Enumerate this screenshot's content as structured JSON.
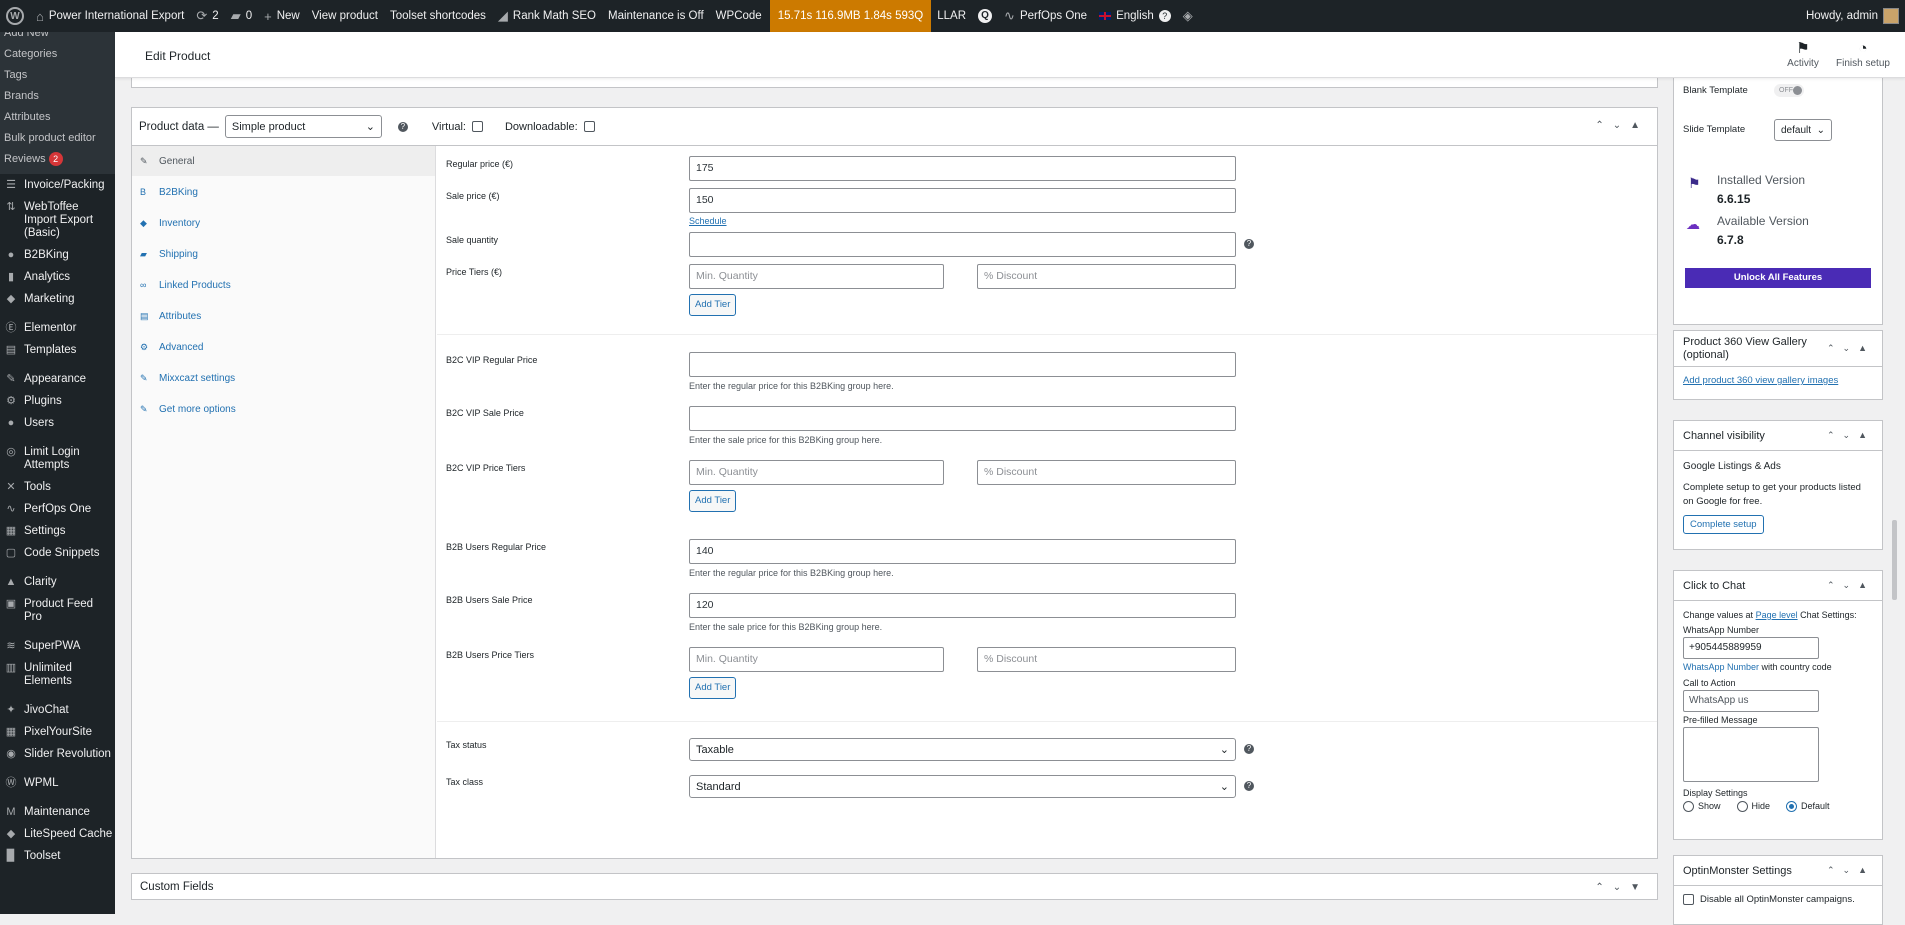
{
  "topbar": {
    "site": "Power International Export",
    "updates": "2",
    "comments": "0",
    "new": "New",
    "view_product": "View product",
    "toolset_shortcodes": "Toolset shortcodes",
    "rank_math": "Rank Math SEO",
    "maintenance": "Maintenance is Off",
    "wpcode": "WPCode",
    "perf": "15.71s  116.9MB  1.84s  593Q",
    "llar": "LLAR",
    "perfops": "PerfOps One",
    "lang": "English",
    "lang_badge": "?",
    "howdy": "Howdy, admin"
  },
  "sidebar": {
    "submenu": [
      "Add New",
      "Categories",
      "Tags",
      "Brands",
      "Attributes",
      "Bulk product editor",
      "Reviews"
    ],
    "reviews_badge": "2",
    "items": [
      {
        "label": "Invoice/Packing",
        "icon": "☰"
      },
      {
        "label": "WebToffee Import Export (Basic)",
        "icon": "⇅"
      },
      {
        "label": "B2BKing",
        "icon": "●"
      },
      {
        "label": "Analytics",
        "icon": "▮"
      },
      {
        "label": "Marketing",
        "icon": "◆"
      },
      {
        "label": "Elementor",
        "icon": "Ⓔ"
      },
      {
        "label": "Templates",
        "icon": "▤"
      },
      {
        "label": "Appearance",
        "icon": "✎"
      },
      {
        "label": "Plugins",
        "icon": "⚙"
      },
      {
        "label": "Users",
        "icon": "●"
      },
      {
        "label": "Limit Login Attempts",
        "icon": "◎"
      },
      {
        "label": "Tools",
        "icon": "✕"
      },
      {
        "label": "PerfOps One",
        "icon": "∿"
      },
      {
        "label": "Settings",
        "icon": "▦"
      },
      {
        "label": "Code Snippets",
        "icon": "▢"
      },
      {
        "label": "Clarity",
        "icon": "▲"
      },
      {
        "label": "Product Feed Pro",
        "icon": "▣"
      },
      {
        "label": "SuperPWA",
        "icon": "≋"
      },
      {
        "label": "Unlimited Elements",
        "icon": "▥"
      },
      {
        "label": "JivoChat",
        "icon": "✦"
      },
      {
        "label": "PixelYourSite",
        "icon": "▦"
      },
      {
        "label": "Slider Revolution",
        "icon": "◉"
      },
      {
        "label": "WPML",
        "icon": "Ⓦ"
      },
      {
        "label": "Maintenance",
        "icon": "M"
      },
      {
        "label": "LiteSpeed Cache",
        "icon": "◆"
      },
      {
        "label": "Toolset",
        "icon": "▉"
      }
    ]
  },
  "header": {
    "title": "Edit Product",
    "activity": "Activity",
    "finish_setup": "Finish setup"
  },
  "product_data": {
    "label": "Product data —",
    "type": "Simple product",
    "virtual": "Virtual:",
    "downloadable": "Downloadable:",
    "tabs": [
      "General",
      "B2BKing",
      "Inventory",
      "Shipping",
      "Linked Products",
      "Attributes",
      "Advanced",
      "Mixxcazt settings",
      "Get more options"
    ],
    "tab_icons": [
      "✎",
      "B",
      "◆",
      "▰",
      "∞",
      "▤",
      "⚙",
      "✎",
      "✎"
    ],
    "regular_price_label": "Regular price (€)",
    "regular_price": "175",
    "sale_price_label": "Sale price (€)",
    "sale_price": "150",
    "schedule": "Schedule",
    "sale_quantity_label": "Sale quantity",
    "sale_quantity": "",
    "price_tiers_label": "Price Tiers (€)",
    "min_quantity_ph": "Min. Quantity",
    "discount_ph": "% Discount",
    "add_tier": "Add Tier",
    "b2c_regular_label": "B2C VIP Regular Price",
    "b2c_regular": "",
    "regular_hint": "Enter the regular price for this B2BKing group here.",
    "b2c_sale_label": "B2C VIP Sale Price",
    "b2c_sale": "",
    "sale_hint": "Enter the sale price for this B2BKing group here.",
    "b2c_tiers_label": "B2C VIP Price Tiers",
    "b2b_regular_label": "B2B Users Regular Price",
    "b2b_regular": "140",
    "b2b_sale_label": "B2B Users Sale Price",
    "b2b_sale": "120",
    "b2b_tiers_label": "B2B Users Price Tiers",
    "tax_status_label": "Tax status",
    "tax_status": "Taxable",
    "tax_class_label": "Tax class",
    "tax_class": "Standard"
  },
  "custom_fields": "Custom Fields",
  "right": {
    "blank_template": "Blank Template",
    "toggle_off": "OFF",
    "slide_template": "Slide Template",
    "slide_value": "default",
    "installed_version_label": "Installed Version",
    "installed_version": "6.6.15",
    "available_version_label": "Available Version",
    "available_version": "6.7.8",
    "unlock": "Unlock All Features",
    "p360_title": "Product 360 View Gallery (optional)",
    "p360_link": "Add product 360 view gallery images",
    "channel_title": "Channel visibility",
    "google": "Google Listings & Ads",
    "google_text": "Complete setup to get your products listed on Google for free.",
    "complete_setup": "Complete setup",
    "chat_title": "Click to Chat",
    "chat_change": "Change values at",
    "page_level": "Page level",
    "chat_settings": "Chat Settings:",
    "whatsapp_label": "WhatsApp Number",
    "whatsapp": "+905445889959",
    "whatsapp_link": "WhatsApp Number",
    "country_code": "with country code",
    "cta_label": "Call to Action",
    "cta": "WhatsApp us",
    "prefilled_label": "Pre-filled Message",
    "display_label": "Display Settings",
    "show": "Show",
    "hide": "Hide",
    "default": "Default",
    "optin_title": "OptinMonster Settings",
    "optin_disable": "Disable all OptinMonster campaigns."
  }
}
